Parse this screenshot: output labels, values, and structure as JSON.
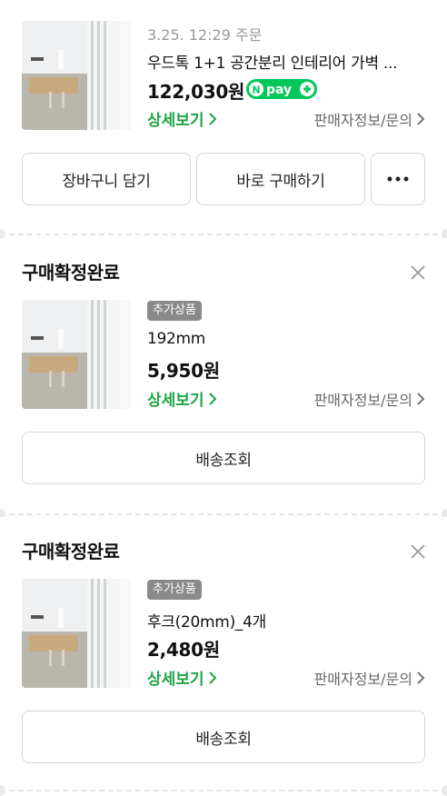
{
  "orders": [
    {
      "date": "3.25. 12:29 주문",
      "product_name": "우드톡 1+1 공간분리 인테리어 가벽 ...",
      "price": "122,030원",
      "npay_label": "pay",
      "detail_link": "상세보기",
      "seller_link": "판매자정보/문의",
      "buttons": {
        "cart": "장바구니 담기",
        "buy_now": "바로 구매하기",
        "more": "•••"
      }
    },
    {
      "status": "구매확정완료",
      "badge": "추가상품",
      "product_name": "192mm",
      "price": "5,950원",
      "detail_link": "상세보기",
      "seller_link": "판매자정보/문의",
      "delivery_button": "배송조회"
    },
    {
      "status": "구매확정완료",
      "badge": "추가상품",
      "product_name": "후크(20mm)_4개",
      "price": "2,480원",
      "detail_link": "상세보기",
      "seller_link": "판매자정보/문의",
      "delivery_button": "배송조회"
    }
  ],
  "colors": {
    "accent_green": "#1ea349",
    "npay_green": "#03c75a",
    "badge_gray": "#8a8a8a",
    "border": "#d5d5d5"
  },
  "icons": [
    "chevron-right-icon",
    "close-icon",
    "npay-plus-icon",
    "more-dots-icon"
  ]
}
